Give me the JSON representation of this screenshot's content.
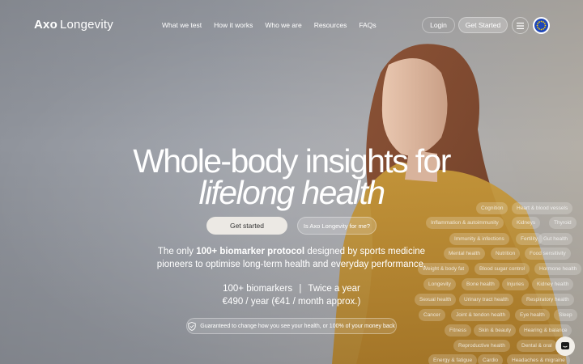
{
  "brand": {
    "logo_bold": "Axo",
    "logo_rest": "Longevity"
  },
  "nav": {
    "items": [
      "What we test",
      "How it works",
      "Who we are",
      "Resources",
      "FAQs"
    ],
    "login": "Login",
    "get_started": "Get Started",
    "menu_icon": "hamburger-icon",
    "region_icon": "eu-flag-icon"
  },
  "hero": {
    "title_line1": "Whole-body insights for",
    "title_line2": "lifelong health",
    "cta_primary": "Get started",
    "cta_secondary": "Is Axo Longevity for me?",
    "desc_pre": "The only ",
    "desc_bold": "100+ biomarker protocol",
    "desc_post": " designed by sports medicine",
    "desc_line2": "pioneers to optimise long-term health and everyday performance.",
    "stat1": "100+ biomarkers",
    "stat_sep": "|",
    "stat2": "Twice a year",
    "price": "€490 / year (€41 / month approx.)",
    "guarantee": "Guaranteed to change how you see your health, or 100% of your money back"
  },
  "tags": [
    "Cognition",
    "Heart & blood vessels",
    "Inflammation & autoimmunity",
    "Kidneys",
    "Thyroid",
    "Immunity & infections",
    "Fertility",
    "Gut health",
    "Mental health",
    "Nutrition",
    "Food sensitivity",
    "Weight & body fat",
    "Blood sugar control",
    "Hormone health",
    "Longevity",
    "Bone health",
    "Injuries",
    "Kidney health",
    "Sexual health",
    "Urinary tract health",
    "Respiratory health",
    "Cancer",
    "Joint & tendon health",
    "Eye health",
    "Sleep",
    "Fitness",
    "Skin & beauty",
    "Hearing & balance",
    "Reproductive health",
    "Dental & oral",
    "Energy & fatigue",
    "Cardio",
    "Headaches & migraine"
  ],
  "chat": {
    "icon": "chat-icon"
  }
}
